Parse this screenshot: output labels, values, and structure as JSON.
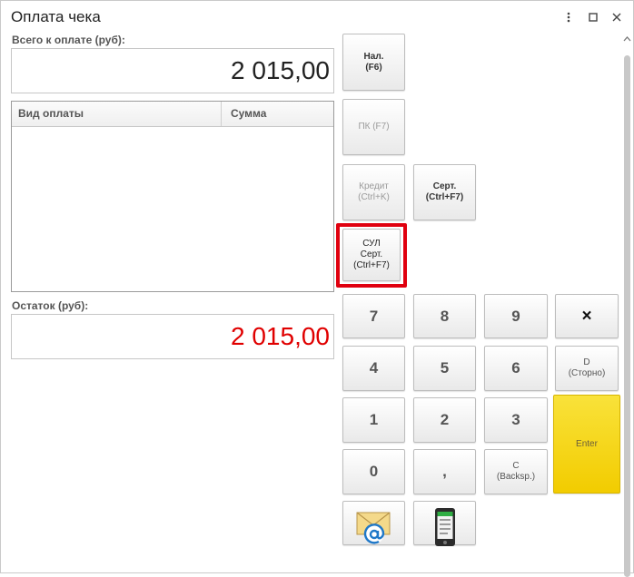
{
  "window": {
    "title": "Оплата чека"
  },
  "total": {
    "label": "Всего к оплате (руб):",
    "value": "2 015,00"
  },
  "payments_table": {
    "columns": [
      "Вид оплаты",
      "Сумма"
    ],
    "rows": []
  },
  "remaining": {
    "label": "Остаток (руб):",
    "value": "2 015,00",
    "color": "#e00000"
  },
  "payment_buttons": {
    "cash": "Нал.\n(F6)",
    "card": "ПК (F7)",
    "credit": "Кредит\n(Ctrl+K)",
    "certificate": "Серт.\n(Ctrl+F7)",
    "sul_certificate": "СУЛ\nСерт.\n(Ctrl+F7)"
  },
  "keypad": {
    "k7": "7",
    "k8": "8",
    "k9": "9",
    "clear": "×",
    "k4": "4",
    "k5": "5",
    "k6": "6",
    "storno": "D\n(Сторно)",
    "k1": "1",
    "k2": "2",
    "k3": "3",
    "enter": "Enter",
    "k0": "0",
    "comma": ",",
    "backspace": "C\n(Backsp.)"
  },
  "icons": {
    "email": "email-at-icon",
    "phone": "mobile-phone-icon",
    "menu": "more-vertical-icon",
    "maximize": "maximize-icon",
    "close": "close-icon"
  },
  "colors": {
    "highlight": "#e0000f",
    "enter": "#f5d300"
  }
}
